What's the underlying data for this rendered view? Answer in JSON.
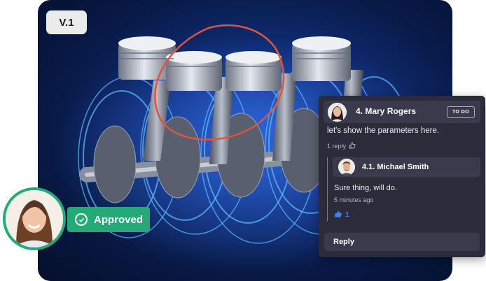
{
  "version_label": "V.1",
  "approval": {
    "label": "Approved",
    "status_color": "#24a978"
  },
  "comment": {
    "author": "4. Mary Rogers",
    "status": "TO DO",
    "text": "let's show the parameters here.",
    "replies_count": "1 reply",
    "reply": {
      "author": "4.1. Michael Smith",
      "text": "Sure thing, will do.",
      "time": "5 minutes ago",
      "likes": "1"
    },
    "reply_button": "Reply"
  },
  "colors": {
    "panel_bg": "#2b2b3a",
    "panel_header": "#3a3a4c",
    "annotation": "#e0533d",
    "like": "#3b82f6"
  }
}
